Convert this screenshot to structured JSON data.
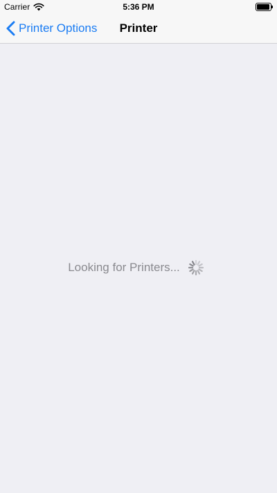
{
  "status_bar": {
    "carrier": "Carrier",
    "time": "5:36 PM",
    "icons": [
      "wifi-icon",
      "battery-icon"
    ]
  },
  "nav_bar": {
    "back_label": "Printer Options",
    "back_icon": "chevron-left-icon",
    "title": "Printer"
  },
  "content": {
    "loading_text": "Looking for Printers...",
    "spinner_icon": "spinner-icon"
  },
  "colors": {
    "accent": "#1a7cf3",
    "background": "#efeff4",
    "bar_background": "#f7f7f7",
    "secondary_text": "#8a8a8f"
  }
}
